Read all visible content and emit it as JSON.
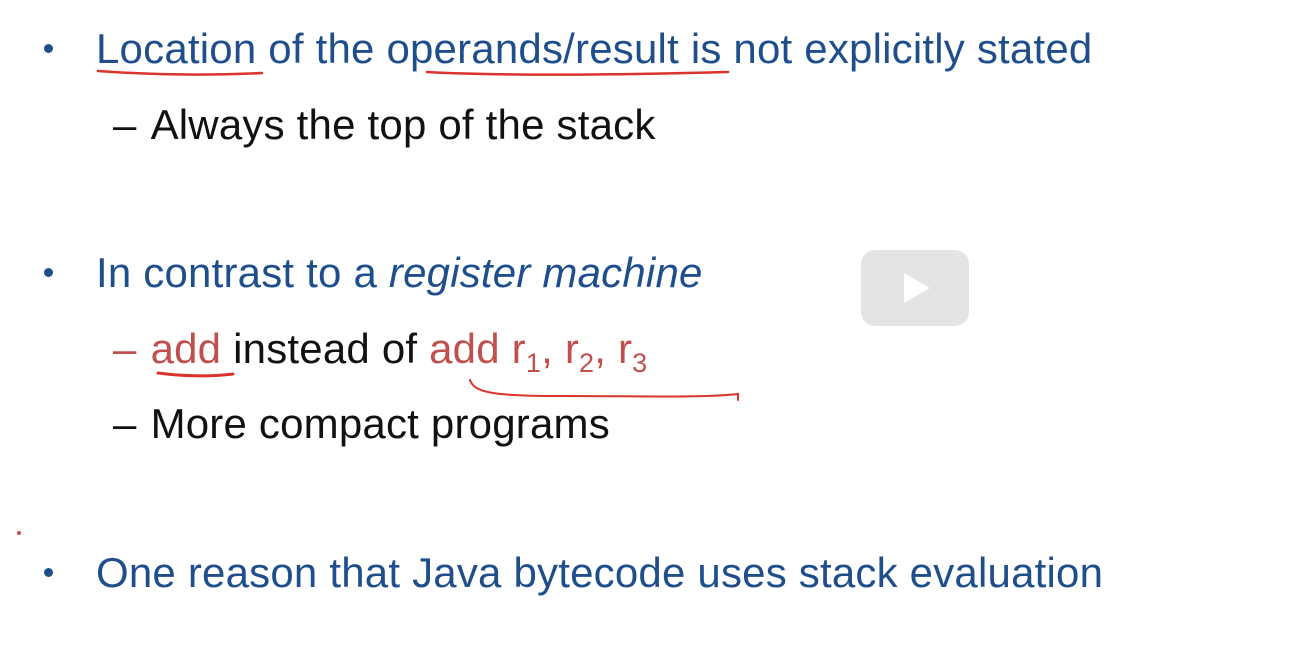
{
  "slide": {
    "bullets": [
      {
        "parts": [
          "Location",
          " of the ",
          "operands/result",
          "  is not explicitly stated"
        ],
        "subitems": [
          {
            "dash": "–",
            "text": "Always the top of the stack"
          }
        ]
      },
      {
        "parts": [
          "In contrast to a ",
          "register machine"
        ],
        "subitems": [
          {
            "dash": "–",
            "a": "add",
            "b": "  instead of ",
            "c": "add r",
            "s1": "1",
            "comma1": ", r",
            "s2": "2",
            "comma2": ", r",
            "s3": "3"
          },
          {
            "dash": "–",
            "text": "More compact programs"
          }
        ]
      },
      {
        "parts": [
          "One reason that Java bytecode uses stack evaluation"
        ]
      }
    ]
  },
  "player": {
    "play_icon": "play-icon"
  },
  "colors": {
    "heading_blue": "#1f4e8c",
    "accent_red": "#c0504d",
    "body_black": "#111111"
  }
}
